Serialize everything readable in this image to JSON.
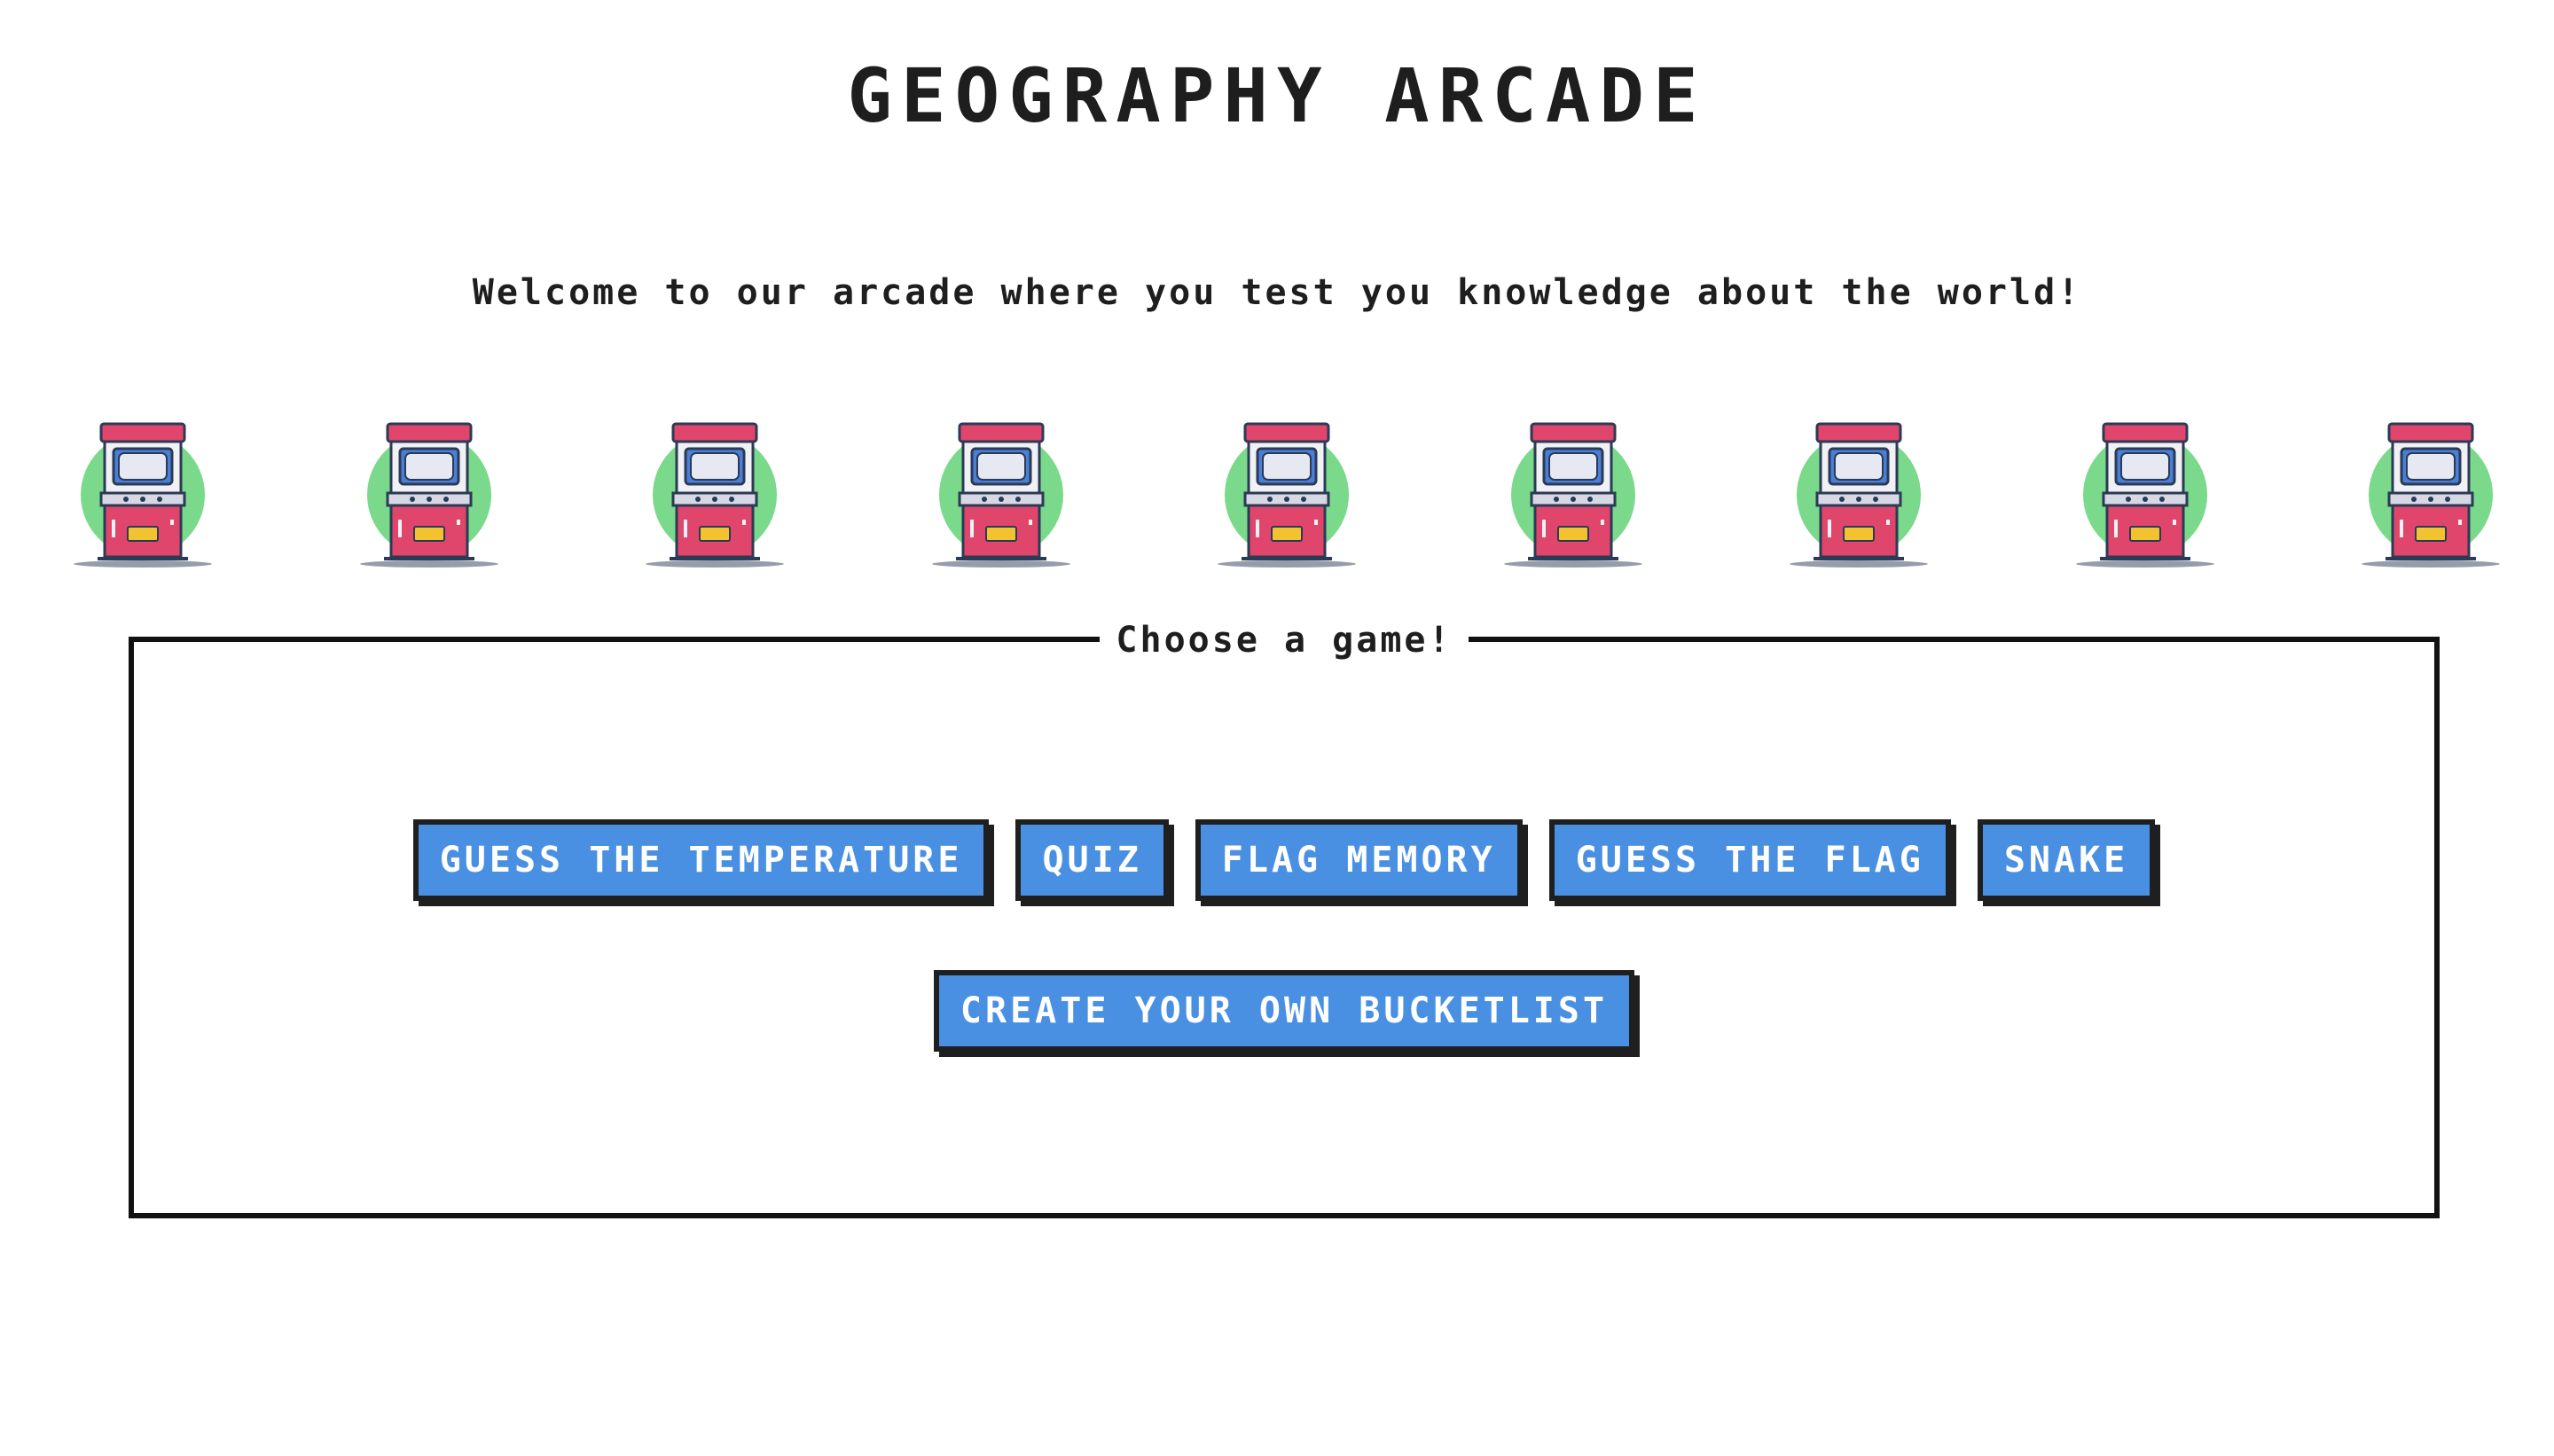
{
  "header": {
    "title": "GEOGRAPHY ARCADE",
    "welcome": "Welcome to our arcade where you test you knowledge about the world!"
  },
  "decoration": {
    "cabinet_icon": "arcade-cabinet-icon",
    "cabinet_count": 9,
    "colors": {
      "circle": "#7ad98b",
      "marquee": "#e0466b",
      "body": "#e0466b",
      "screen": "#4a7fd8",
      "coin_slot": "#f2c230",
      "outline": "#2b3a55"
    }
  },
  "game_menu": {
    "legend": "Choose a game!",
    "buttons": [
      {
        "label": "GUESS THE TEMPERATURE"
      },
      {
        "label": "QUIZ"
      },
      {
        "label": "FLAG MEMORY"
      },
      {
        "label": "GUESS THE FLAG"
      },
      {
        "label": "SNAKE"
      }
    ],
    "bucketlist_button": {
      "label": "CREATE YOUR OWN BUCKETLIST"
    }
  },
  "colors": {
    "button_bg": "#4a90e2",
    "button_text": "#ffffff",
    "button_border": "#1f1f1f",
    "text": "#1e1e1e",
    "background": "#ffffff"
  }
}
